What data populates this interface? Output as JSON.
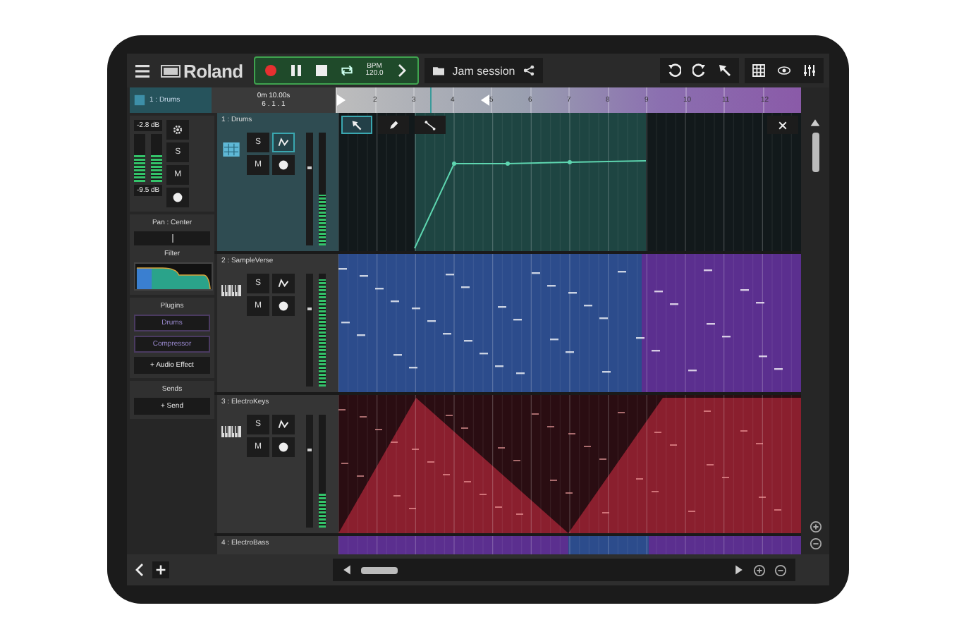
{
  "topbar": {
    "logo": "Roland",
    "bpm_label": "BPM",
    "bpm_value": "120.0",
    "session": "Jam session"
  },
  "ruler": {
    "track_label": "1 : Drums",
    "time": "0m 10.00s",
    "position": "6 . 1 . 1",
    "bars": [
      "2",
      "3",
      "4",
      "5",
      "6",
      "7",
      "8",
      "9",
      "10",
      "11",
      "12"
    ]
  },
  "inspector": {
    "peak": "-2.8 dB",
    "volume": "-9.5 dB",
    "meters": [
      {
        "level": 0.55
      },
      {
        "level": 0.55
      }
    ],
    "solo": "S",
    "mute": "M",
    "pan": "Pan : Center",
    "pan_slider": {
      "level": 0.5
    },
    "filter": "Filter",
    "plugins_title": "Plugins",
    "plugins": [
      "Drums",
      "Compressor"
    ],
    "add_effect": "+ Audio Effect",
    "sends_title": "Sends",
    "add_send": "+ Send"
  },
  "tracks": [
    {
      "name": "1 : Drums",
      "kind": "drums",
      "selected": true,
      "solo": "S",
      "mute": "M",
      "automation": true,
      "level": 0.45,
      "clips": [
        {
          "color": "#1e4542"
        }
      ]
    },
    {
      "name": "2 : SampleVerse",
      "kind": "keys",
      "selected": false,
      "solo": "S",
      "mute": "M",
      "automation": false,
      "level": 0.95,
      "clips": [
        {
          "color": "#2c4c8c"
        },
        {
          "color": "#5b2f8f"
        }
      ]
    },
    {
      "name": "3 : ElectroKeys",
      "kind": "keys",
      "selected": false,
      "solo": "S",
      "mute": "M",
      "automation": false,
      "level": 0.3,
      "clips": [
        {
          "color": "#8a1f2e"
        }
      ]
    },
    {
      "name": "4 : ElectroBass",
      "kind": "keys",
      "selected": false,
      "clips": [
        {
          "color": "#5b2f8f"
        },
        {
          "color": "#2c4c8c"
        },
        {
          "color": "#5b2f8f"
        }
      ]
    }
  ]
}
